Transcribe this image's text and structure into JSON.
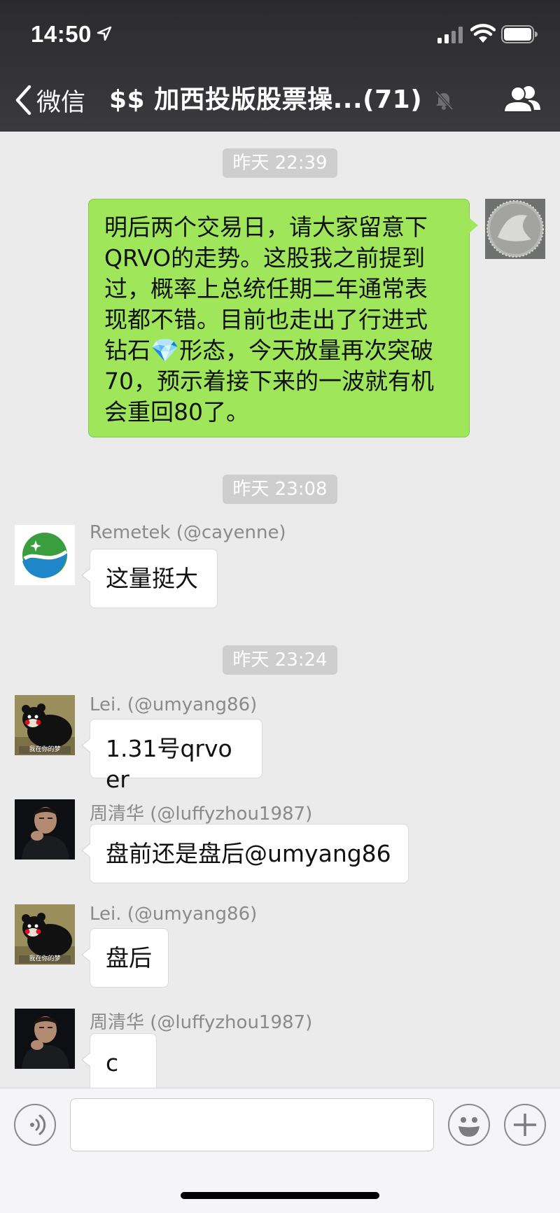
{
  "status_bar": {
    "time": "14:50"
  },
  "nav": {
    "back_label": "微信",
    "title": "$$ 加西投版股票操...(71)"
  },
  "messages": [
    {
      "type": "timestamp",
      "text": "昨天 22:39"
    },
    {
      "type": "outgoing",
      "lines": [
        "明后两个交易日，请大家留意下",
        "QRVO的走势。这股我之前提到",
        "过，概率上总统任期二年通常表",
        "现都不错。目前也走出了行进式",
        "钻石💎形态，今天放量再次突破",
        "70，预示着接下来的一波就有机",
        "会重回80了。"
      ]
    },
    {
      "type": "timestamp",
      "text": "昨天 23:08"
    },
    {
      "type": "incoming",
      "sender": "Remetek (@cayenne)",
      "text": "这量挺大"
    },
    {
      "type": "timestamp",
      "text": "昨天 23:24"
    },
    {
      "type": "incoming",
      "sender": "Lei. (@umyang86)",
      "text": "1.31号qrvo er"
    },
    {
      "type": "incoming",
      "sender": "周清华 (@luffyzhou1987)",
      "text": "盘前还是盘后@umyang86"
    },
    {
      "type": "incoming",
      "sender": "Lei. (@umyang86)",
      "text": "盘后"
    },
    {
      "type": "incoming",
      "sender": "周清华 (@luffyzhou1987)",
      "text": "c"
    }
  ],
  "avatar_captions": {
    "bear": "我在你的梦"
  },
  "input": {
    "value": ""
  },
  "colors": {
    "outgoing_bubble": "#9fe65a",
    "incoming_bubble": "#ffffff",
    "background": "#ebebeb",
    "header": "#2f2f32"
  },
  "icons": [
    "location-arrow-icon",
    "signal-icon",
    "wifi-icon",
    "battery-icon",
    "chevron-left-icon",
    "mute-bell-icon",
    "group-members-icon",
    "voice-icon",
    "emoji-icon",
    "plus-icon"
  ]
}
